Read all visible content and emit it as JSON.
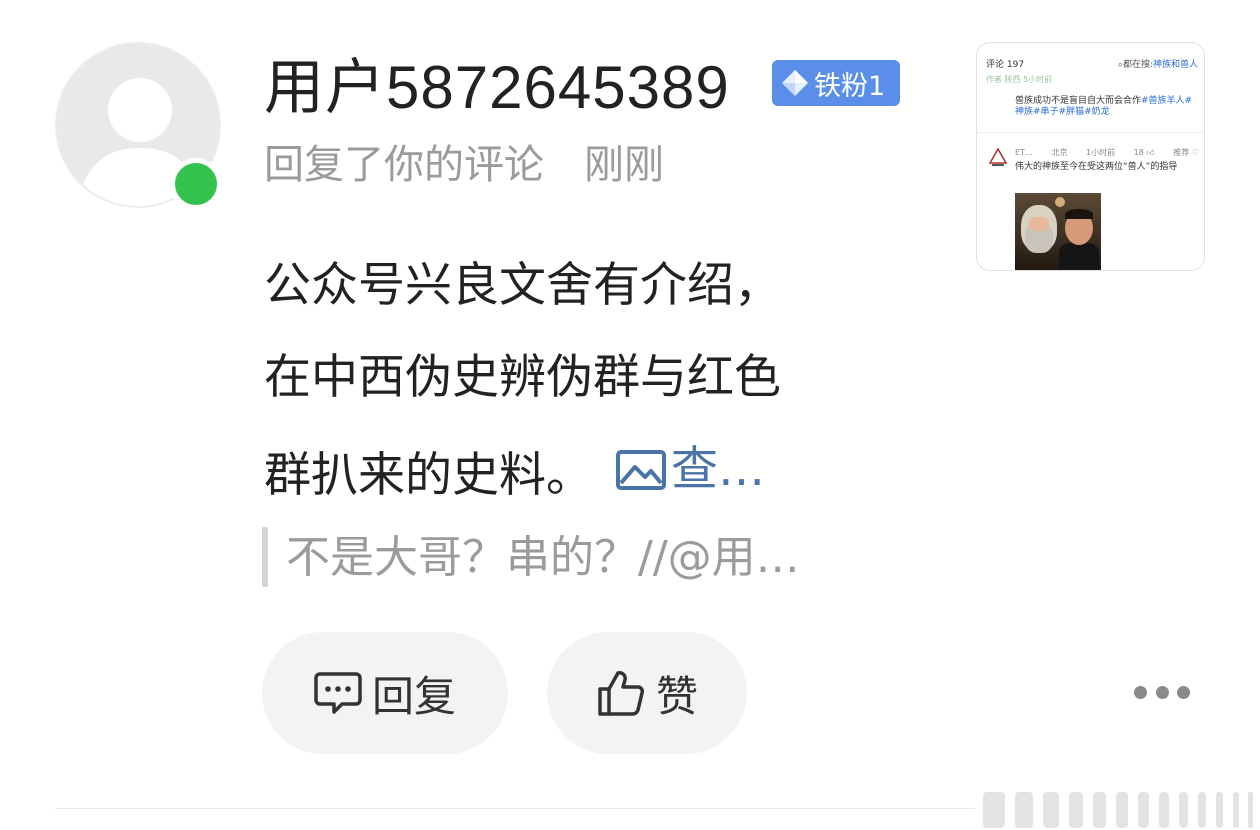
{
  "user": {
    "name": "用户5872645389",
    "badge": "铁粉1",
    "online": true
  },
  "notification": {
    "action": "回复了你的评论",
    "time": "刚刚"
  },
  "comment": {
    "lines": [
      "公众号兴良文舍有介绍，",
      "在中西伪史辨伪群与红色",
      "群扒来的史料。"
    ],
    "see_image_label": "查…"
  },
  "quote": {
    "text": "不是大哥？串的？//@用…"
  },
  "actions": {
    "reply_label": "回复",
    "like_label": "赞"
  },
  "thumbnail": {
    "comment_count_label": "评论 197",
    "search_prefix": "都在搜:",
    "search_term": "神族和兽人",
    "prev_meta": "作者  陕西  5小时前",
    "comment1_text": "兽族成功不是盲目自大而会合作",
    "comment1_tags": "#兽族羊人#神族#串子#胖猫#奶龙",
    "comment2_user": "ET…",
    "comment2_location": "北京",
    "comment2_time": "1小时前",
    "comment2_likes": "18",
    "comment2_recommend": "推荐",
    "comment2_text": "伟大的神族至今在受这两位“兽人”的指导"
  },
  "colors": {
    "online_dot": "#33c24d",
    "badge_bg": "#5b8ee8",
    "link": "#4a73a8",
    "muted_text": "#9b9b9b"
  }
}
